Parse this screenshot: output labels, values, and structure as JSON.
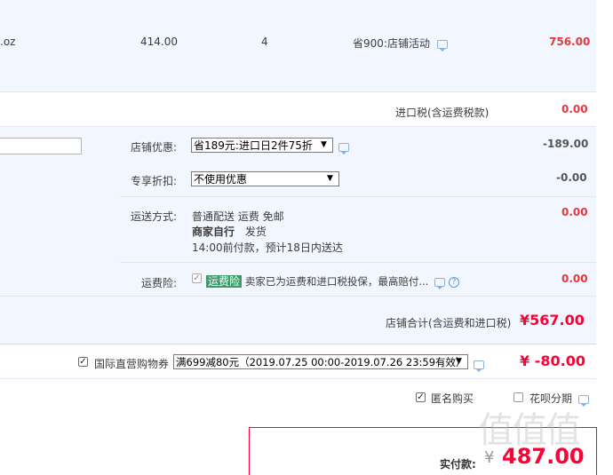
{
  "item": {
    "name_fragment": ".oz",
    "unit_price": "414.00",
    "quantity": "4",
    "promo": "省900:店铺活动",
    "subtotal": "756.00"
  },
  "import_tax": {
    "label": "进口税(含运费税款)",
    "value": "0.00"
  },
  "shop_discount": {
    "label": "店铺优惠:",
    "selected": "省189元:进口日2件75折",
    "value": "-189.00"
  },
  "exclusive_discount": {
    "label": "专享折扣:",
    "selected": "不使用优惠",
    "value": "-0.00"
  },
  "shipping": {
    "label": "运送方式:",
    "method": "普通配送 运费 免邮",
    "seller_self": "商家自行",
    "dispatch": "发货",
    "eta": "14:00前付款，预计18日内送达",
    "value": "0.00"
  },
  "freight_insurance": {
    "label": "运费险:",
    "tag": "运费险",
    "text": "卖家已为运费和进口税投保，最高赔付...",
    "value": "0.00"
  },
  "shop_total": {
    "label": "店铺合计(含运费和进口税)",
    "value": "¥567.00"
  },
  "coupon": {
    "label": "国际直营购物券",
    "selected": "满699减80元（2019.07.25 00:00-2019.07.26 23:59有效）",
    "value": "¥ -80.00"
  },
  "options": {
    "anonymous": "匿名购买",
    "installment": "花呗分期"
  },
  "payment": {
    "label": "实付款:",
    "currency": "¥",
    "amount": "487.00"
  },
  "watermark": "值值值"
}
